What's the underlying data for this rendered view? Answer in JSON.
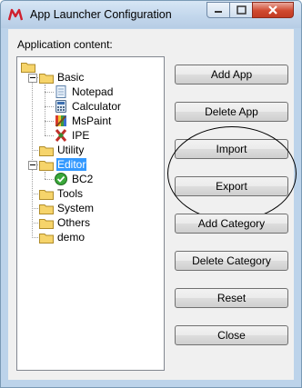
{
  "window": {
    "title": "App Launcher Configuration"
  },
  "icons": {
    "app": "microchip-logo-icon",
    "folder": "folder-icon",
    "notepad": "notepad-icon",
    "calculator": "calculator-icon",
    "mspaint": "paint-palette-icon",
    "ipe": "ipe-icon",
    "bc2": "green-check-circle-icon"
  },
  "colors": {
    "selection": "#3399ff",
    "close_button": "#c13b23",
    "folder": "#f6d46b"
  },
  "main": {
    "content_label": "Application content:"
  },
  "tree": {
    "nodes": [
      {
        "label": "Basic"
      },
      {
        "label": "Notepad"
      },
      {
        "label": "Calculator"
      },
      {
        "label": "MsPaint"
      },
      {
        "label": "IPE"
      },
      {
        "label": "Utility"
      },
      {
        "label": "Editor",
        "selected": true
      },
      {
        "label": "BC2"
      },
      {
        "label": "Tools"
      },
      {
        "label": "System"
      },
      {
        "label": "Others"
      },
      {
        "label": "demo"
      }
    ]
  },
  "buttons": {
    "add_app": "Add App",
    "delete_app": "Delete App",
    "import": "Import",
    "export": "Export",
    "add_category": "Add Category",
    "delete_category": "Delete Category",
    "reset": "Reset",
    "close": "Close"
  }
}
